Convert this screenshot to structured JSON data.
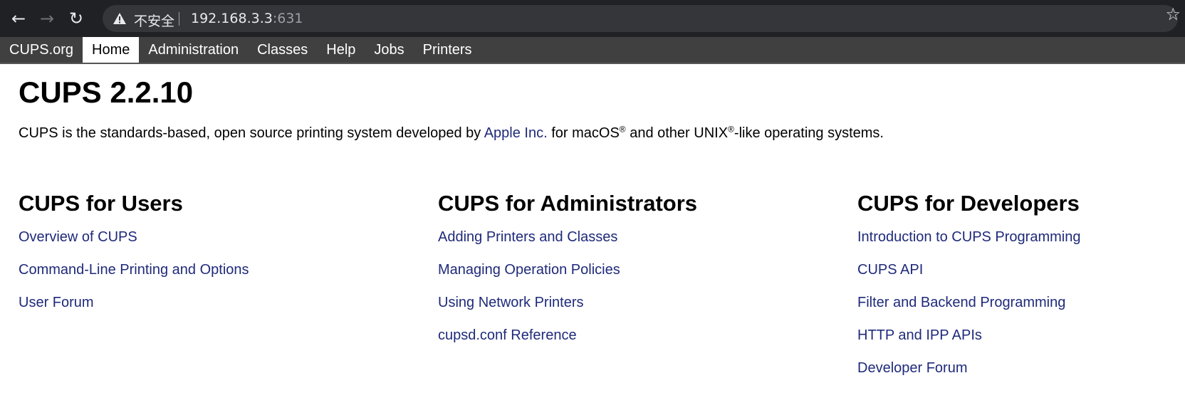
{
  "browser": {
    "back_icon": "arrow-left-icon",
    "forward_icon": "arrow-right-icon",
    "reload_icon": "reload-icon",
    "security_label": "不安全",
    "url_host": "192.168.3.3",
    "url_port": ":631",
    "bookmark_icon": "star-icon"
  },
  "nav": {
    "items": [
      {
        "label": "CUPS.org",
        "active": false
      },
      {
        "label": "Home",
        "active": true
      },
      {
        "label": "Administration",
        "active": false
      },
      {
        "label": "Classes",
        "active": false
      },
      {
        "label": "Help",
        "active": false
      },
      {
        "label": "Jobs",
        "active": false
      },
      {
        "label": "Printers",
        "active": false
      }
    ]
  },
  "page": {
    "title": "CUPS 2.2.10",
    "intro_part1": "CUPS is the standards-based, open source printing system developed by ",
    "intro_link": "Apple Inc.",
    "intro_part2": " for macOS",
    "intro_part3": " and other UNIX",
    "intro_part4": "-like operating systems.",
    "registered_mark": "®"
  },
  "sections": [
    {
      "heading": "CUPS for Users",
      "links": [
        "Overview of CUPS",
        "Command-Line Printing and Options",
        "User Forum"
      ]
    },
    {
      "heading": "CUPS for Administrators",
      "links": [
        "Adding Printers and Classes",
        "Managing Operation Policies",
        "Using Network Printers",
        "cupsd.conf Reference"
      ]
    },
    {
      "heading": "CUPS for Developers",
      "links": [
        "Introduction to CUPS Programming",
        "CUPS API",
        "Filter and Backend Programming",
        "HTTP and IPP APIs",
        "Developer Forum"
      ]
    }
  ],
  "colors": {
    "link": "#1f2a7a",
    "nav_bg": "#404040",
    "chrome_bg": "#202124"
  }
}
